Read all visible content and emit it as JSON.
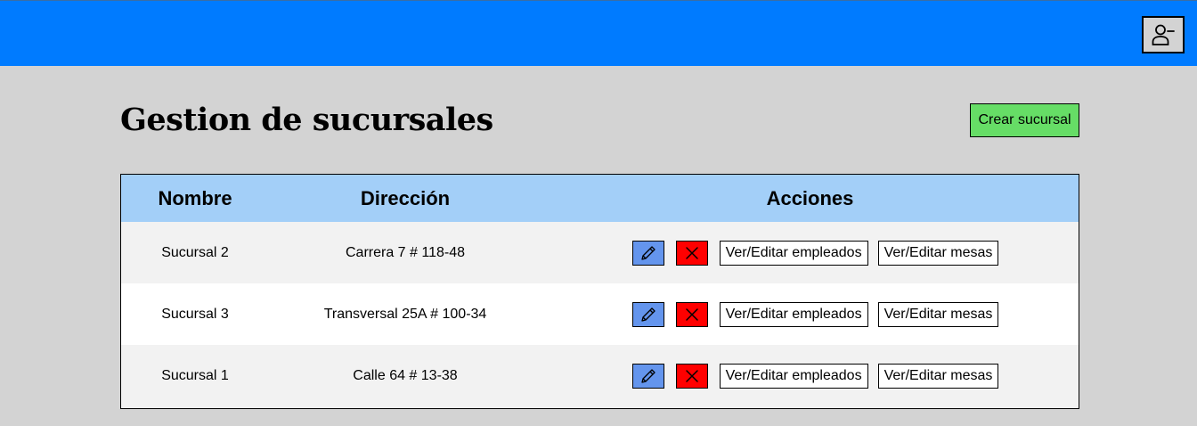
{
  "header": {
    "user_icon": "user-minus-icon",
    "color": "#007bff"
  },
  "page": {
    "title": "Gestion de sucursales",
    "create_button": "Crear sucursal"
  },
  "table": {
    "columns": [
      "Nombre",
      "Dirección",
      "Acciones"
    ],
    "rows": [
      {
        "nombre": "Sucursal 2",
        "direccion": "Carrera 7 # 118-48"
      },
      {
        "nombre": "Sucursal 3",
        "direccion": "Transversal 25A # 100-34"
      },
      {
        "nombre": "Sucursal 1",
        "direccion": "Calle 64 # 13-38"
      }
    ],
    "actions": {
      "edit_icon": "pencil-icon",
      "delete_icon": "x-icon",
      "employees_label": "Ver/Editar empleados",
      "tables_label": "Ver/Editar mesas"
    }
  },
  "colors": {
    "background": "#d3d3d3",
    "header_row": "#a3cff8",
    "create_button": "#66dd66",
    "edit_button": "#6495ed",
    "delete_button": "#ff0000"
  }
}
